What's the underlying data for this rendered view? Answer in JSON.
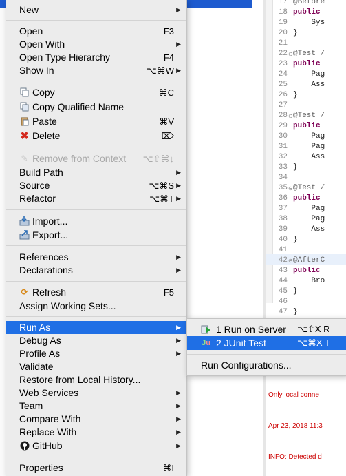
{
  "editor": {
    "lines": [
      {
        "n": "17",
        "code": "@Before"
      },
      {
        "n": "18",
        "code": "public"
      },
      {
        "n": "19",
        "code": "    Sys"
      },
      {
        "n": "20",
        "code": "}"
      },
      {
        "n": "21",
        "code": ""
      },
      {
        "n": "22",
        "code": "@Test /"
      },
      {
        "n": "23",
        "code": "public"
      },
      {
        "n": "24",
        "code": "    Pag"
      },
      {
        "n": "25",
        "code": "    Ass"
      },
      {
        "n": "26",
        "code": "}"
      },
      {
        "n": "27",
        "code": ""
      },
      {
        "n": "28",
        "code": "@Test /"
      },
      {
        "n": "29",
        "code": "public"
      },
      {
        "n": "30",
        "code": "    Pag"
      },
      {
        "n": "31",
        "code": "    Pag"
      },
      {
        "n": "32",
        "code": "    Ass"
      },
      {
        "n": "33",
        "code": "}"
      },
      {
        "n": "34",
        "code": ""
      },
      {
        "n": "35",
        "code": "@Test /"
      },
      {
        "n": "36",
        "code": "public"
      },
      {
        "n": "37",
        "code": "    Pag"
      },
      {
        "n": "38",
        "code": "    Pag"
      },
      {
        "n": "39",
        "code": "    Ass"
      },
      {
        "n": "40",
        "code": "}"
      },
      {
        "n": "41",
        "code": ""
      },
      {
        "n": "42",
        "code": "@AfterC"
      },
      {
        "n": "43",
        "code": "public"
      },
      {
        "n": "44",
        "code": "    Bro"
      },
      {
        "n": "45",
        "code": "}"
      },
      {
        "n": "46",
        "code": ""
      },
      {
        "n": "47",
        "code": "}"
      }
    ]
  },
  "console": {
    "lines": [
      "Only local conne",
      "Apr 23, 2018 11:3",
      "INFO: Detected d"
    ]
  },
  "menu": {
    "new": "New",
    "open": "Open",
    "open_sc": "F3",
    "open_with": "Open With",
    "open_type_hierarchy": "Open Type Hierarchy",
    "open_type_hierarchy_sc": "F4",
    "show_in": "Show In",
    "show_in_sc": "⌥⌘W",
    "copy": "Copy",
    "copy_sc": "⌘C",
    "copy_qualified": "Copy Qualified Name",
    "paste": "Paste",
    "paste_sc": "⌘V",
    "delete": "Delete",
    "delete_sc": "⌦",
    "remove_from_context": "Remove from Context",
    "remove_from_context_sc": "⌥⇧⌘↓",
    "build_path": "Build Path",
    "source": "Source",
    "source_sc": "⌥⌘S",
    "refactor": "Refactor",
    "refactor_sc": "⌥⌘T",
    "import": "Import...",
    "export": "Export...",
    "references": "References",
    "declarations": "Declarations",
    "refresh": "Refresh",
    "refresh_sc": "F5",
    "assign_working_sets": "Assign Working Sets...",
    "run_as": "Run As",
    "debug_as": "Debug As",
    "profile_as": "Profile As",
    "validate": "Validate",
    "restore_local_history": "Restore from Local History...",
    "web_services": "Web Services",
    "team": "Team",
    "compare_with": "Compare With",
    "replace_with": "Replace With",
    "github": "GitHub",
    "properties": "Properties",
    "properties_sc": "⌘I"
  },
  "submenu": {
    "run_on_server": "1 Run on Server",
    "run_on_server_sc": "⌥⇧X R",
    "junit_test": "2 JUnit Test",
    "junit_test_sc": "⌥⌘X T",
    "run_configurations": "Run Configurations..."
  },
  "colors": {
    "selection": "#1f6fe5",
    "menu_bg": "#ececec"
  }
}
